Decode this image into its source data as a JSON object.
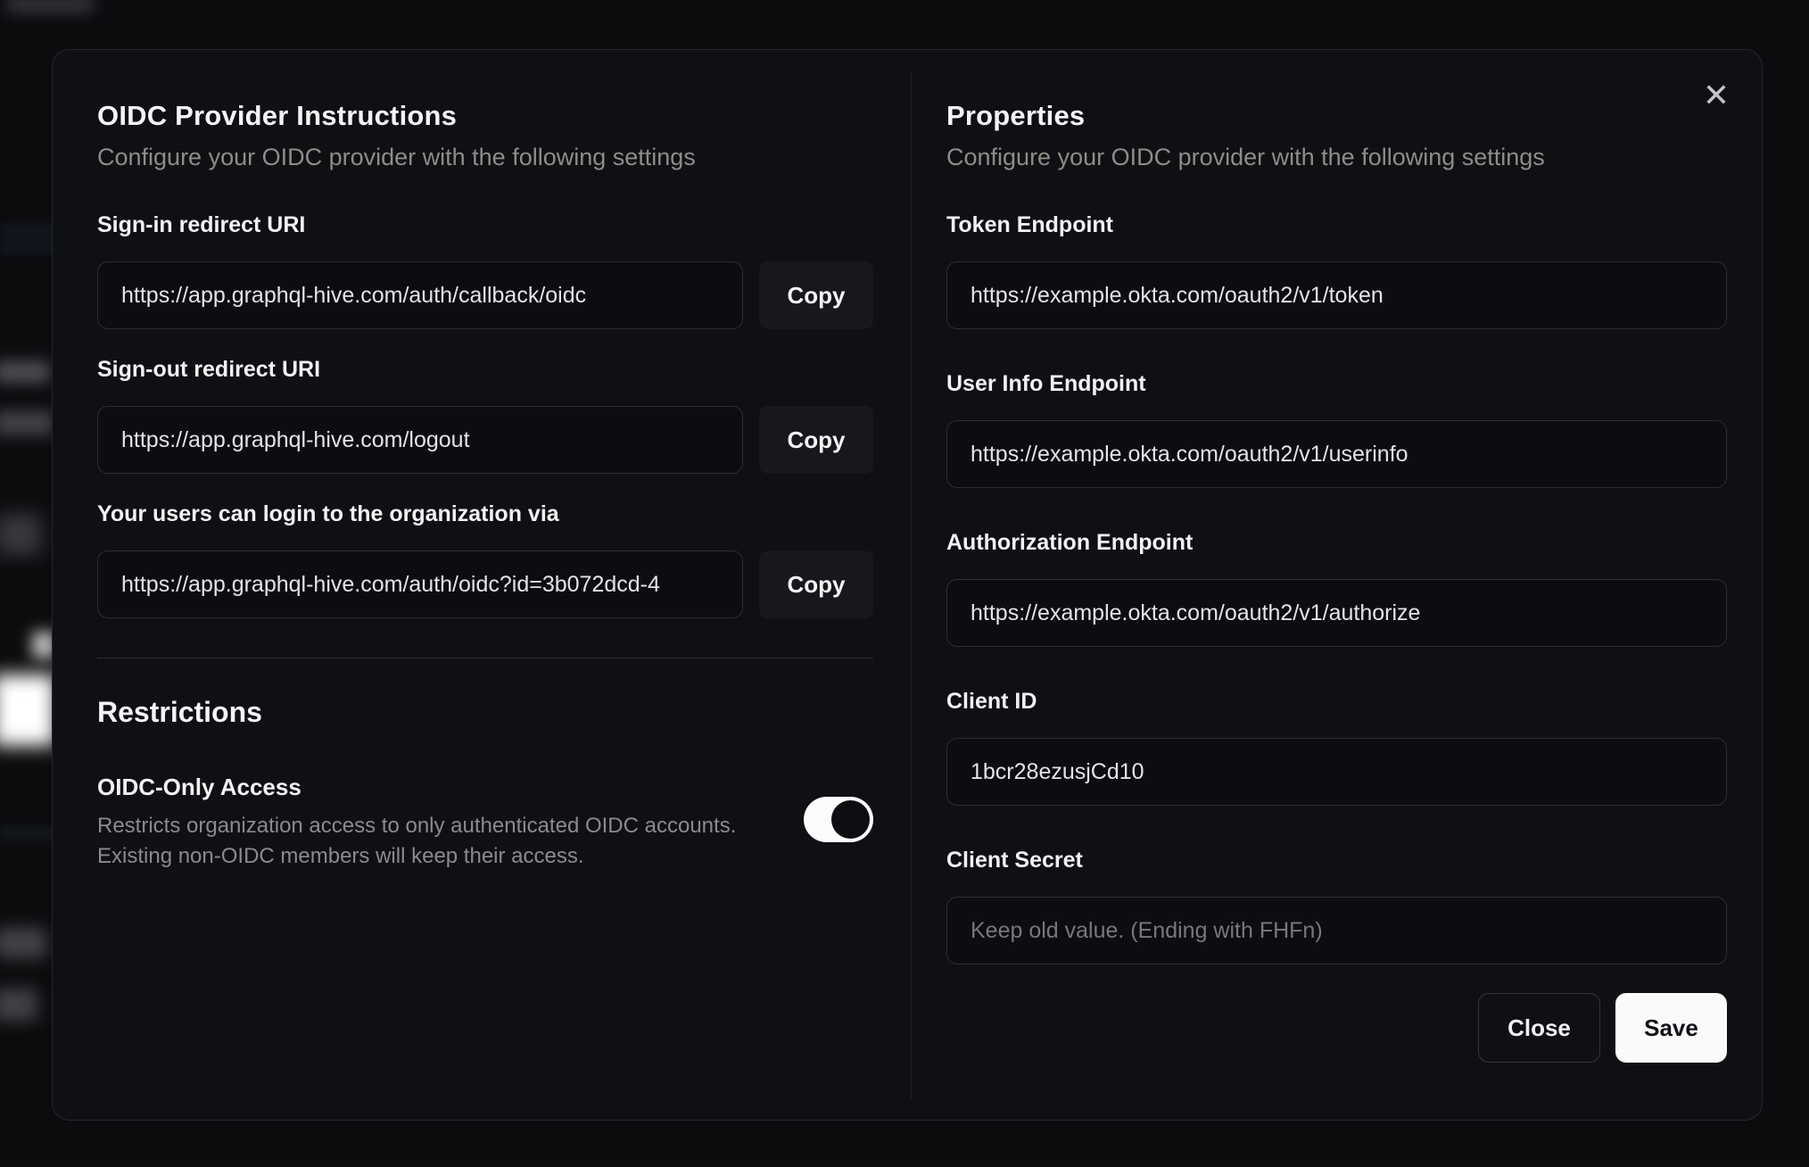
{
  "modal": {
    "close_icon": "✕",
    "left": {
      "title": "OIDC Provider Instructions",
      "subtitle": "Configure your OIDC provider with the following settings",
      "fields": [
        {
          "label": "Sign-in redirect URI",
          "value": "https://app.graphql-hive.com/auth/callback/oidc",
          "action": "Copy"
        },
        {
          "label": "Sign-out redirect URI",
          "value": "https://app.graphql-hive.com/logout",
          "action": "Copy"
        },
        {
          "label": "Your users can login to the organization via",
          "value": "https://app.graphql-hive.com/auth/oidc?id=3b072dcd-4",
          "action": "Copy"
        }
      ],
      "restrictions": {
        "title": "Restrictions",
        "toggle_label": "OIDC-Only Access",
        "description_line1": "Restricts organization access to only authenticated OIDC accounts.",
        "description_line2": "Existing non-OIDC members will keep their access.",
        "toggle_state": "on"
      }
    },
    "right": {
      "title": "Properties",
      "subtitle": "Configure your OIDC provider with the following settings",
      "fields": [
        {
          "label": "Token Endpoint",
          "value": "https://example.okta.com/oauth2/v1/token"
        },
        {
          "label": "User Info Endpoint",
          "value": "https://example.okta.com/oauth2/v1/userinfo"
        },
        {
          "label": "Authorization Endpoint",
          "value": "https://example.okta.com/oauth2/v1/authorize"
        },
        {
          "label": "Client ID",
          "value": "1bcr28ezusjCd10"
        },
        {
          "label": "Client Secret",
          "value": "",
          "placeholder": "Keep old value. (Ending with FHFn)"
        }
      ],
      "buttons": {
        "close": "Close",
        "save": "Save"
      }
    }
  },
  "colors": {
    "page_bg": "#0b0c0e",
    "modal_bg": "#0f1013",
    "input_border": "#2d2e33",
    "copy_button_bg": "#17181c",
    "save_button_bg": "#fafafa",
    "toggle_on": "#fcfcfc",
    "muted_text": "#8f8c88"
  }
}
